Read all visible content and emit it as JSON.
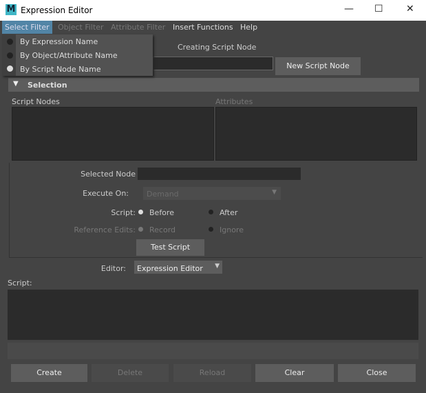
{
  "window": {
    "title": "Expression Editor",
    "min": "—",
    "max": "☐",
    "close": "✕"
  },
  "menu": [
    "Select Filter",
    "Object Filter",
    "Attribute Filter",
    "Insert Functions",
    "Help"
  ],
  "dropdown": [
    {
      "label": "By Expression Name",
      "selected": false
    },
    {
      "label": "By Object/Attribute Name",
      "selected": false
    },
    {
      "label": "By Script Node Name",
      "selected": true
    }
  ],
  "mode_label": "Creating Script Node",
  "new_button": "New Script Node",
  "section": "Selection",
  "script_nodes_label": "Script Nodes",
  "attributes_label": "Attributes",
  "selected_node_label": "Selected Node",
  "execute_on_label": "Execute On:",
  "execute_on_value": "Demand",
  "script_label": "Script:",
  "before": "Before",
  "after": "After",
  "ref_edits_label": "Reference Edits:",
  "record": "Record",
  "ignore": "Ignore",
  "test_script": "Test Script",
  "editor_label": "Editor:",
  "editor_value": "Expression Editor",
  "script_area_label": "Script:",
  "buttons": [
    "Create",
    "Delete",
    "Reload",
    "Clear",
    "Close"
  ]
}
